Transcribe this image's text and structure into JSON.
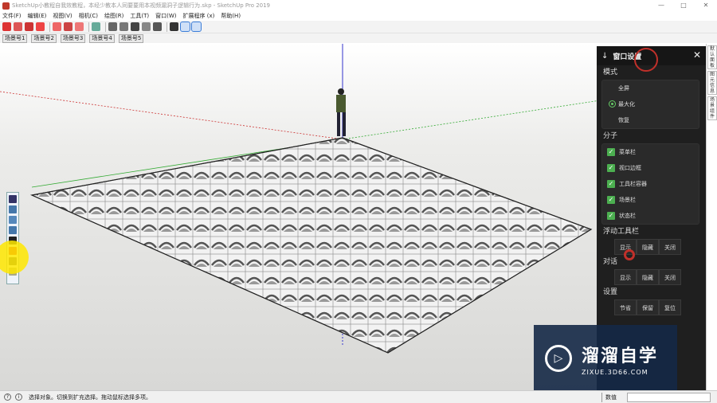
{
  "window": {
    "title": "SketchUp小教程自我效教程，本经少教本人同要要用本视频漏洞子逻辑行为.skp - SketchUp Pro 2019",
    "controls": [
      "—",
      "□",
      "✕"
    ]
  },
  "menu": {
    "items": [
      "文件(F)",
      "编辑(E)",
      "视图(V)",
      "相机(C)",
      "绘图(R)",
      "工具(T)",
      "窗口(W)",
      "扩展程序 (x)",
      "帮助(H)"
    ]
  },
  "scenes": {
    "tabs": [
      "场景号1",
      "场景号2",
      "场景号3",
      "场景号4",
      "场景号5"
    ]
  },
  "panel": {
    "title": "窗口设置",
    "close": "✕",
    "mode": {
      "label": "模式",
      "options": [
        "全屏",
        "最大化",
        "恢复"
      ],
      "selected": "最大化"
    },
    "components": {
      "label": "分子",
      "items": [
        "菜单栏",
        "视口边框",
        "工具栏容器",
        "场景栏",
        "状态栏"
      ]
    },
    "floating": {
      "label": "浮动工具栏",
      "buttons": [
        "显示",
        "隐藏",
        "关闭"
      ]
    },
    "dialogs": {
      "label": "对话",
      "buttons": [
        "显示",
        "隐藏",
        "关闭"
      ]
    },
    "settings": {
      "label": "设置",
      "buttons": [
        "节省",
        "保留",
        "复位"
      ]
    }
  },
  "rightstrip": {
    "items": [
      "默认面板",
      "图元信息",
      "场景组件"
    ]
  },
  "status": {
    "text": "选择对象。切换到扩充选择。拖动鼠标选择多项。",
    "vcb_label": "数值",
    "vcb_value": ""
  },
  "watermark": {
    "brand": "溜溜自学",
    "url": "ZIXUE.3D66.COM"
  },
  "colors": {
    "panel_bg": "#1f1f1f",
    "check_green": "#4caf50",
    "accent_red": "#c0302a",
    "watermark_bg": "#14284a"
  }
}
